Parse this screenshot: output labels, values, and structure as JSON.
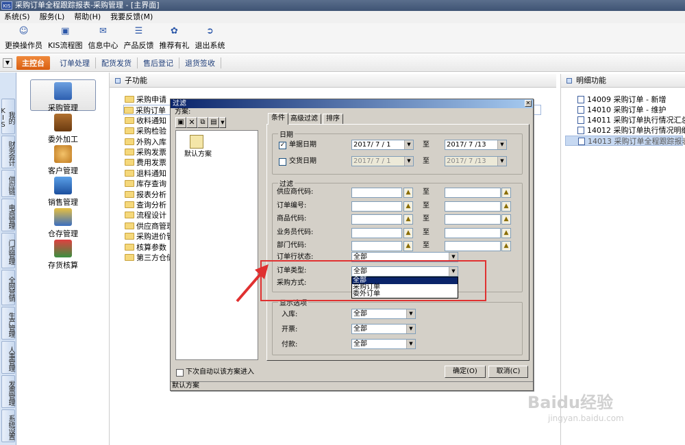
{
  "window": {
    "title": "采购订单全程跟踪报表-采购管理 - [主界面]",
    "logo": "KIS"
  },
  "menu": [
    "系统(S)",
    "服务(L)",
    "帮助(H)",
    "我要反馈(M)"
  ],
  "toolbar": [
    "更换操作员",
    "KIS流程图",
    "信息中心",
    "产品反馈",
    "推荐有礼",
    "退出系统"
  ],
  "tabs": {
    "main": "主控台",
    "items": [
      "订单处理",
      "配货发货",
      "售后登记",
      "退货签收"
    ]
  },
  "vtabs": [
    "我的KIS",
    "财务会计",
    "供应链",
    "电商管理",
    "门店管理",
    "全网营销",
    "生产管理",
    "人事管理",
    "发票管理",
    "系统设置"
  ],
  "modules": [
    "采购管理",
    "委外加工",
    "客户管理",
    "销售管理",
    "仓存管理",
    "存货核算"
  ],
  "subpanel": {
    "title": "子功能",
    "items": [
      "采购申请",
      "采购订单",
      "收料通知",
      "采购检验",
      "外购入库",
      "采购发票",
      "费用发票",
      "退料通知",
      "库存查询",
      "报表分析",
      "查询分析",
      "流程设计",
      "供应商管理",
      "采购进价管",
      "核算参数",
      "第三方仓储"
    ]
  },
  "detail": {
    "title": "明细功能",
    "items": [
      "14009  采购订单 - 新增",
      "14010  采购订单 - 维护",
      "14011  采购订单执行情况汇总表",
      "14012  采购订单执行情况明细表",
      "14013  采购订单全程跟踪报表"
    ]
  },
  "dialog": {
    "title": "过滤",
    "scheme_label": "方案:",
    "scheme_item": "默认方案",
    "tabs": [
      "条件",
      "高级过滤",
      "排序"
    ],
    "date_group": "日期",
    "bill_date_label": "单据日期",
    "bill_date_from": "2017/ 7 / 1",
    "bill_date_to": "2017/ 7 /13",
    "delivery_date_label": "交货日期",
    "delivery_date_from": "2017/ 7 / 1",
    "delivery_date_to": "2017/ 7 /13",
    "to": "至",
    "filter_group": "过滤",
    "filter_rows": [
      "供应商代码:",
      "订单编号:",
      "商品代码:",
      "业务员代码:",
      "部门代码:"
    ],
    "line_status_label": "订单行状态:",
    "line_status_value": "全部",
    "order_type_label": "订单类型:",
    "order_type_value": "全部",
    "order_type_options": [
      "全部",
      "采购订单",
      "委外订单"
    ],
    "purchase_method_label": "采购方式:",
    "display_group": "显示选项",
    "display_rows": [
      {
        "label": "入库:",
        "value": "全部"
      },
      {
        "label": "开票:",
        "value": "全部"
      },
      {
        "label": "付款:",
        "value": "全部"
      }
    ],
    "auto_enter": "下次自动以该方案进入",
    "ok": "确定(O)",
    "cancel": "取消(C)",
    "status": "默认方案"
  },
  "watermark": {
    "brand": "Baidu经验",
    "url": "jingyan.baidu.com"
  },
  "colors": {
    "highlight": "#e03030",
    "dialog_title": "#0a246a",
    "main_tab": "#e8731f"
  }
}
